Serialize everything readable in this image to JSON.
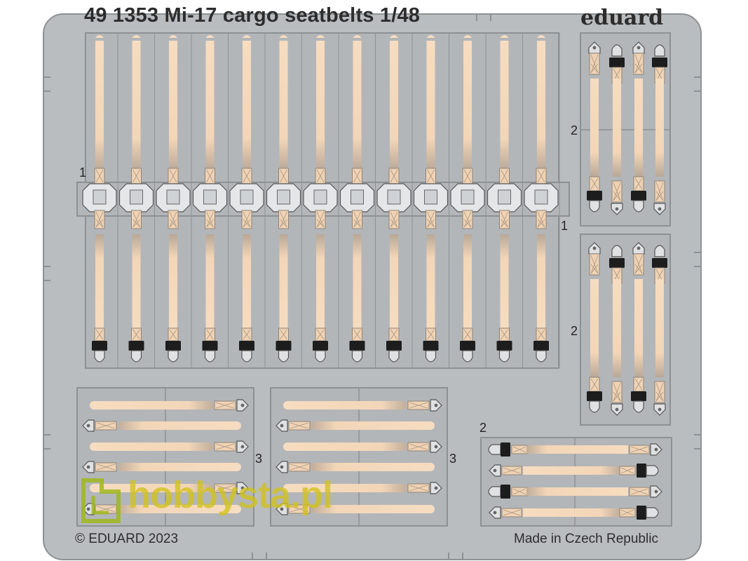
{
  "title": "49 1353 Mi-17 cargo seatbelts 1/48",
  "brand": "eduard",
  "copyright": "© EDUARD 2023",
  "origin": "Made in Czech Republic",
  "part_numbers": {
    "main_left": "1",
    "main_right": "1",
    "side_upper": "2",
    "side_lower": "2",
    "bottom_right": "2",
    "bottom_left": "3",
    "bottom_mid": "3"
  },
  "watermark": "hobbysta.pl",
  "colors": {
    "fret": "#babdc0",
    "fret_edge": "#8e9194",
    "belt": "#f3d8bb",
    "belt_shadow": "#c9b19a",
    "buckle": "#d8dadd",
    "black_clip": "#1d1d1d",
    "watermark": "#d2c21c"
  }
}
